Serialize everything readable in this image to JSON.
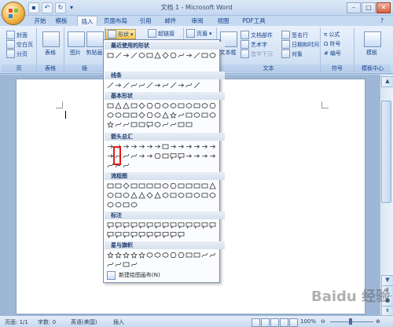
{
  "window": {
    "title": "文档 1 - Microsoft Word"
  },
  "tabs": [
    "开始",
    "模板",
    "插入",
    "页面布局",
    "引用",
    "邮件",
    "审阅",
    "视图",
    "PDF工具"
  ],
  "active_tab": "插入",
  "ribbon": {
    "pages_group": {
      "label": "页",
      "items": [
        "封面",
        "空白页",
        "分页"
      ]
    },
    "table_group": {
      "label": "表格",
      "button": "表格"
    },
    "illus_group": {
      "label": "插",
      "picture": "图片",
      "clipart": "剪贴画",
      "shapes": "形状"
    },
    "links_group": {
      "hyperlink": "超链接"
    },
    "header_group": {
      "header": "页眉"
    },
    "text_group": {
      "label": "文本",
      "textbox": "文本框",
      "parts": "文档部件",
      "wordart": "艺术字",
      "dropcap": "首字下沉",
      "signature": "签名行",
      "datetime": "日期和时间",
      "object": "对象"
    },
    "symbols_group": {
      "label": "符号",
      "equation": "公式",
      "symbol": "符号",
      "number": "编号"
    },
    "template_group": {
      "label": "模板中心",
      "button": "模板"
    }
  },
  "dropdown": {
    "sections": [
      "最近使用的形状",
      "线条",
      "基本形状",
      "箭头总汇",
      "流程图",
      "标注",
      "星与旗帜"
    ],
    "new_canvas": "新建绘图画布(N)"
  },
  "status": {
    "page": "页面: 1/1",
    "words": "字数: 0",
    "lang": "英语(美国)",
    "mode": "插入",
    "zoom": "100%"
  },
  "watermark": "Baidu 经验",
  "colors": {
    "accent": "#15428b",
    "ribbon": "#d3e2f5",
    "highlight": "#e21a1a"
  }
}
